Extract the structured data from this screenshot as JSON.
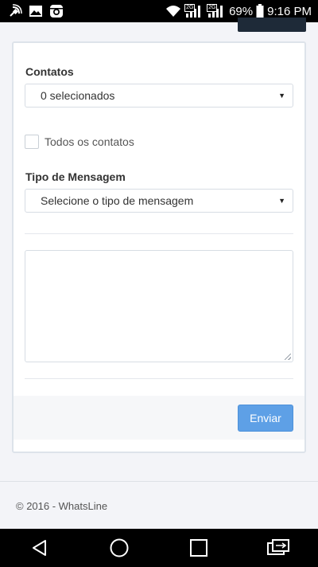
{
  "status_bar": {
    "battery": "69%",
    "time": "9:16 PM",
    "network_tag_1": "2G",
    "network_tag_2": "2G",
    "icons": [
      "satellite-signal-icon",
      "gallery-icon",
      "instagram-icon",
      "wifi-icon",
      "signal-icon",
      "signal-icon",
      "battery-icon"
    ]
  },
  "form": {
    "contacts_label": "Contatos",
    "contacts_select_value": "0 selecionados",
    "all_contacts_label": "Todos os contatos",
    "all_contacts_checked": false,
    "message_type_label": "Tipo de Mensagem",
    "message_type_select_value": "Selecione o tipo de mensagem",
    "message_text": "",
    "send_label": "Enviar"
  },
  "footer": {
    "copyright": "© 2016 - WhatsLine"
  },
  "colors": {
    "accent": "#5ea0e6",
    "background": "#f3f4f8",
    "card_border": "#dde3ea"
  },
  "nav": {
    "icons": [
      "back-icon",
      "home-icon",
      "recents-icon",
      "dual-window-icon"
    ]
  }
}
